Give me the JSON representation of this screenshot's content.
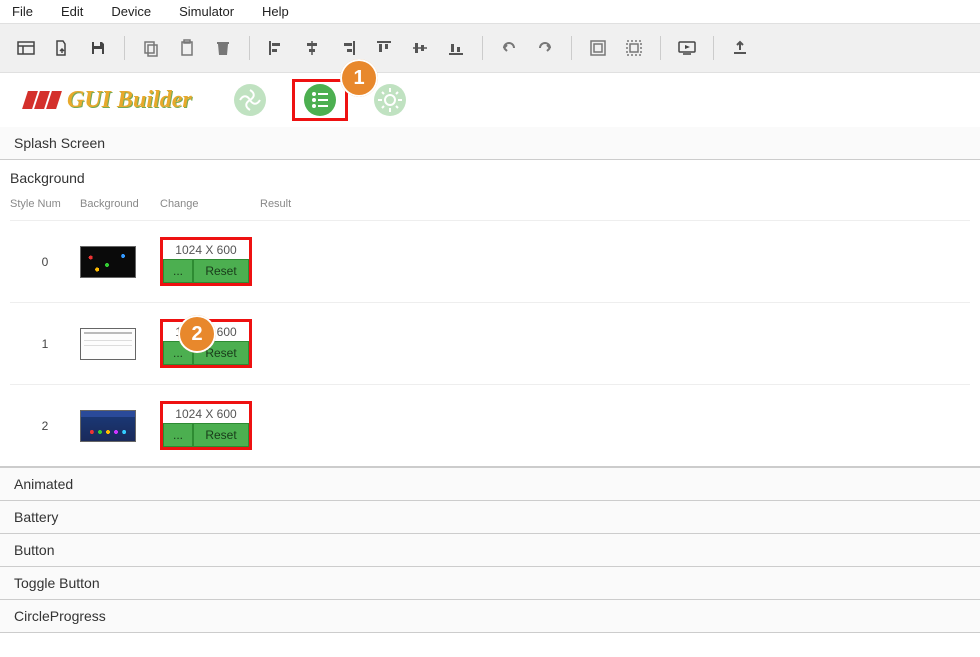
{
  "menu": {
    "file": "File",
    "edit": "Edit",
    "device": "Device",
    "simulator": "Simulator",
    "help": "Help"
  },
  "app_title": "GUI Builder",
  "callouts": {
    "one": "1",
    "two": "2"
  },
  "sections": {
    "splash": "Splash Screen",
    "background": "Background",
    "animated": "Animated",
    "battery": "Battery",
    "button": "Button",
    "toggle_button": "Toggle Button",
    "circle_progress": "CircleProgress"
  },
  "columns": {
    "style_num": "Style Num",
    "background": "Background",
    "change": "Change",
    "result": "Result"
  },
  "rows": [
    {
      "num": "0",
      "dim": "1024 X 600",
      "ellipsis": "...",
      "reset": "Reset"
    },
    {
      "num": "1",
      "dim": "1024 X 600",
      "ellipsis": "...",
      "reset": "Reset"
    },
    {
      "num": "2",
      "dim": "1024 X 600",
      "ellipsis": "...",
      "reset": "Reset"
    }
  ]
}
